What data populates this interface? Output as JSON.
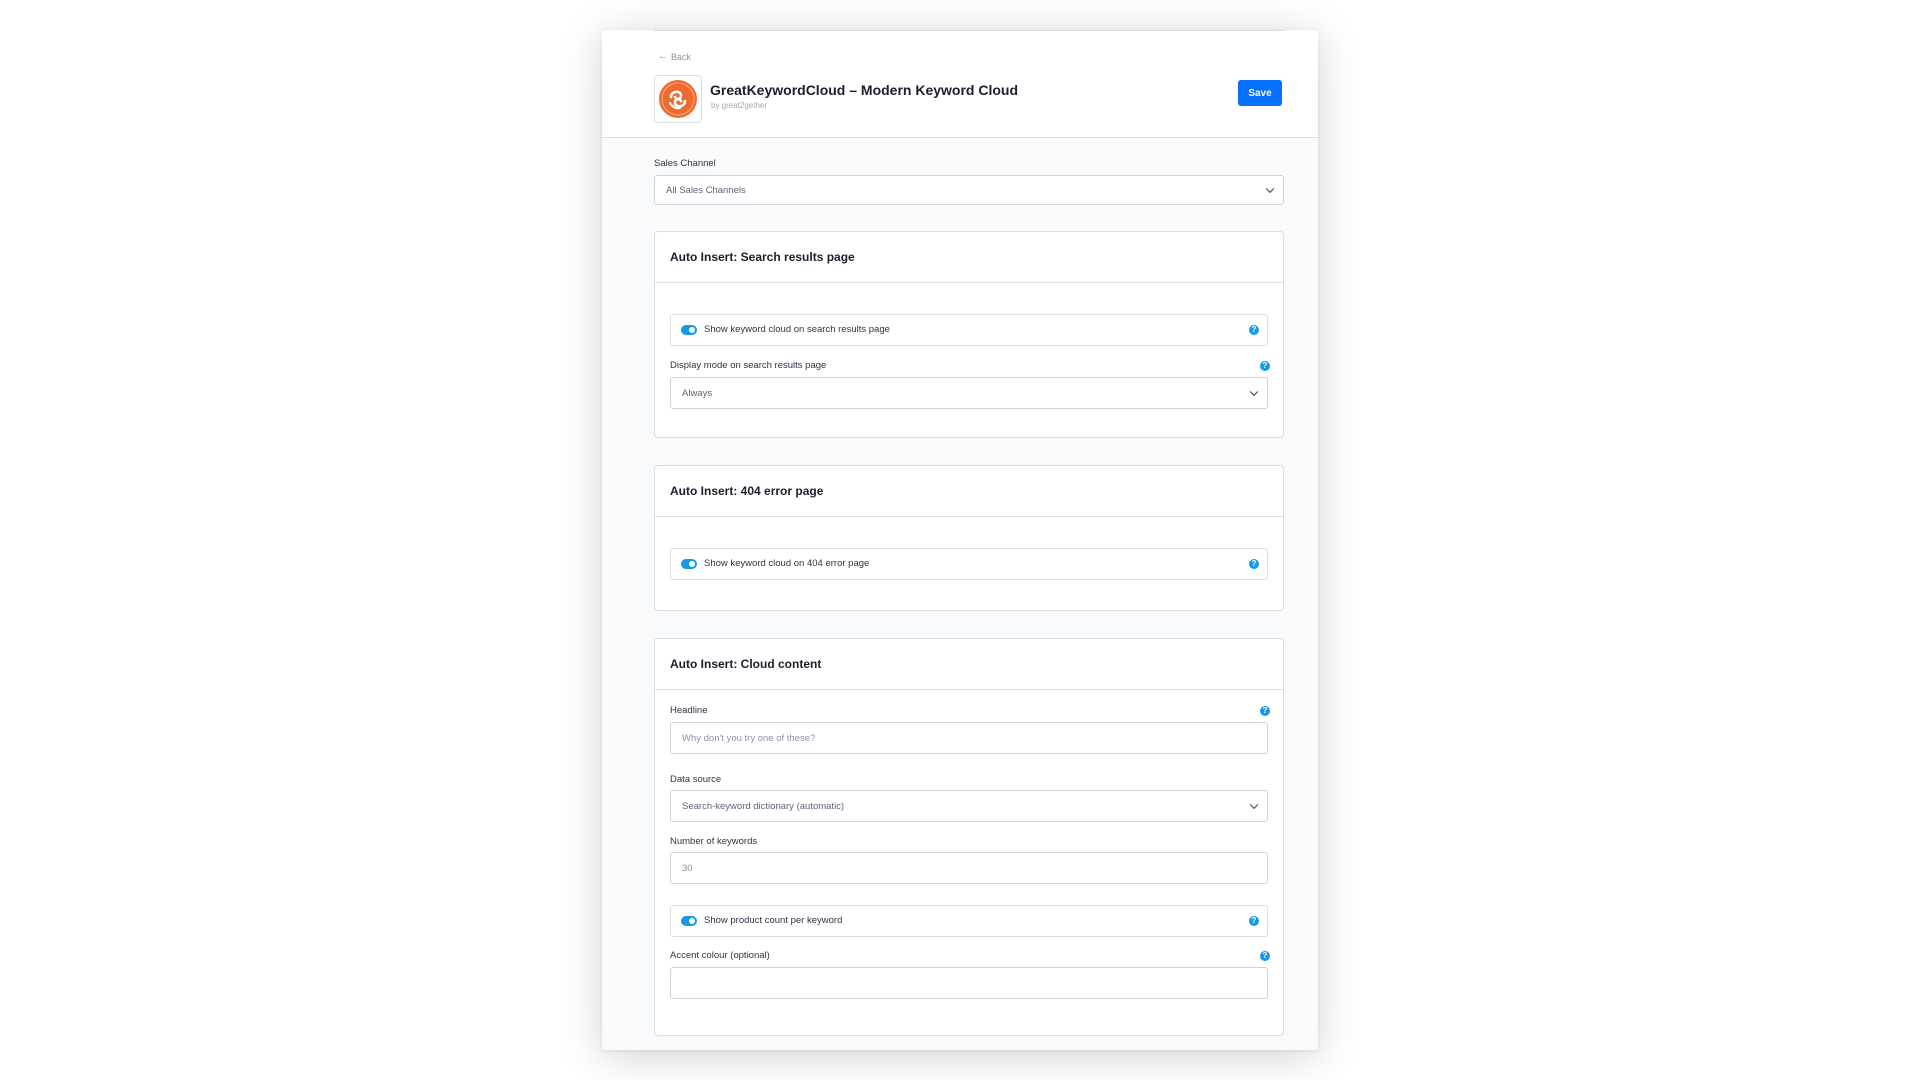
{
  "header": {
    "back_label": "Back",
    "back_arrow": "←",
    "app_title": "GreatKeywordCloud – Modern Keyword Cloud",
    "app_author": "by great2gether",
    "save_label": "Save"
  },
  "sales_channel": {
    "label": "Sales Channel",
    "value": "All Sales Channels"
  },
  "cards": {
    "search_results": {
      "title": "Auto Insert: Search results page",
      "toggle_label": "Show keyword cloud on search results page",
      "display_mode_label": "Display mode on search results page",
      "display_mode_value": "Always"
    },
    "error_404": {
      "title": "Auto Insert: 404 error page",
      "toggle_label": "Show keyword cloud on 404 error page"
    },
    "cloud_content": {
      "title": "Auto Insert: Cloud content",
      "headline_label": "Headline",
      "headline_placeholder": "Why don't you try one of these?",
      "data_source_label": "Data source",
      "data_source_value": "Search-keyword dictionary (automatic)",
      "num_keywords_label": "Number of keywords",
      "num_keywords_value": "30",
      "product_count_toggle_label": "Show product count per keyword",
      "accent_label": "Accent colour (optional)",
      "accent_value": ""
    }
  },
  "help_glyph": "?",
  "colors": {
    "accent": "#0870ff",
    "toggle": "#1898e8",
    "logo": "#ef6a2e"
  }
}
